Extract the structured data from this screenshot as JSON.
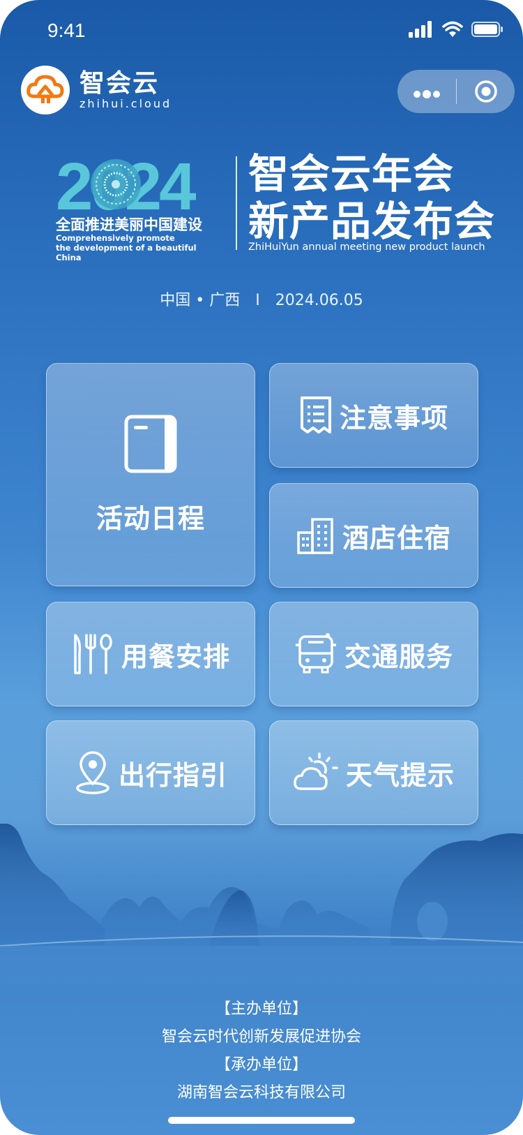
{
  "status_bar": {
    "time": "9:41"
  },
  "brand": {
    "name_cn": "智会云",
    "name_en": "zhihui.cloud"
  },
  "capsule": {
    "more_icon": "more-dots-icon",
    "close_icon": "record-circle-icon"
  },
  "hero": {
    "year": "2024",
    "slogan_cn": "全面推进美丽中国建设",
    "slogan_en_1": "Comprehensively promote",
    "slogan_en_2": "the development of a beautiful China",
    "title_line1": "智会云年会",
    "title_line2": "新产品发布会",
    "title_en": "ZhiHuiYun annual meeting new product launch"
  },
  "place_date": "中国 • 广西　I　2024.06.05",
  "menu": {
    "schedule": {
      "label": "活动日程",
      "icon": "booklet-icon"
    },
    "notes": {
      "label": "注意事项",
      "icon": "receipt-icon"
    },
    "hotel": {
      "label": "酒店住宿",
      "icon": "buildings-icon"
    },
    "dining": {
      "label": "用餐安排",
      "icon": "cutlery-icon"
    },
    "transport": {
      "label": "交通服务",
      "icon": "bus-icon"
    },
    "guide": {
      "label": "出行指引",
      "icon": "location-pin-icon"
    },
    "weather": {
      "label": "天气提示",
      "icon": "sun-cloud-icon"
    }
  },
  "footer": {
    "organizer_heading": "【主办单位】",
    "organizer": "智会云时代创新发展促进协会",
    "undertaker_heading": "【承办单位】",
    "undertaker": "湖南智会云科技有限公司"
  }
}
